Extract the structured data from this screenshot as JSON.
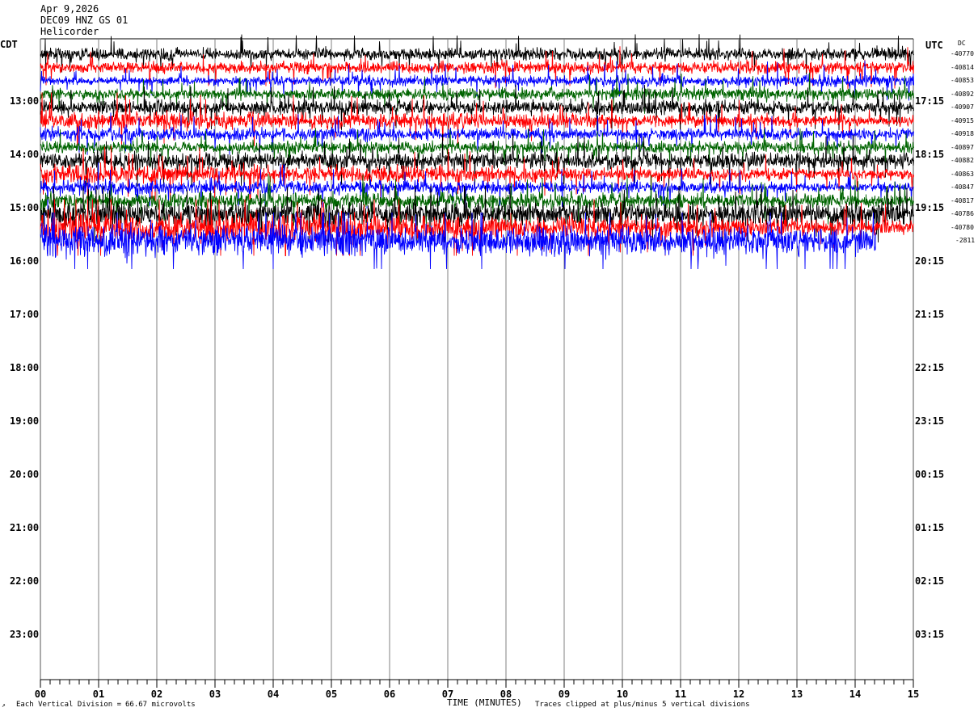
{
  "header": {
    "date": "Apr 9,2026",
    "station": "DEC09 HNZ GS 01",
    "network_label": "Helicorder"
  },
  "left_timezone": "CDT",
  "right_timezone": "UTC",
  "dc_label": "DC",
  "footer": {
    "scale_label": "Each Vertical Division =",
    "scale_value": "66.67 microvolts",
    "clip_note": "Traces clipped at plus/minus 5 vertical divisions",
    "x_axis_label": "TIME (MINUTES)"
  },
  "chart_data": {
    "type": "line",
    "title": "",
    "xlabel": "TIME (MINUTES)",
    "ylabel": "",
    "xlim": [
      0,
      15
    ],
    "x_ticks": [
      "00",
      "01",
      "02",
      "03",
      "04",
      "05",
      "06",
      "07",
      "08",
      "09",
      "10",
      "11",
      "12",
      "13",
      "14",
      "15"
    ],
    "grid": true,
    "left_hour_labels": [
      "13:00",
      "14:00",
      "15:00",
      "16:00",
      "17:00",
      "18:00",
      "19:00",
      "20:00",
      "21:00",
      "22:00",
      "23:00"
    ],
    "right_hour_labels": [
      "17:15",
      "18:15",
      "19:15",
      "20:15",
      "21:15",
      "22:15",
      "23:15",
      "00:15",
      "01:15",
      "02:15",
      "03:15"
    ],
    "trace_colors": [
      "#000000",
      "#ff0000",
      "#0000ff",
      "#006400"
    ],
    "dc_offsets": [
      "-40770",
      "-40814",
      "-40853",
      "-40892",
      "-40907",
      "-40915",
      "-40918",
      "-40897",
      "-40882",
      "-40863",
      "-40847",
      "-40817",
      "-40786",
      "-40780",
      "-2811"
    ],
    "series": [
      {
        "values": [
          0.35,
          0.38
        ]
      },
      {
        "values": [
          0.33,
          0.4
        ]
      },
      {
        "values": [
          0.25,
          0.4
        ]
      },
      {
        "values": [
          0.28,
          0.42
        ]
      },
      {
        "values": [
          0.45,
          0.4
        ]
      },
      {
        "values": [
          0.55,
          0.35
        ]
      },
      {
        "values": [
          0.42,
          0.32
        ]
      },
      {
        "values": [
          0.35,
          0.38
        ]
      },
      {
        "values": [
          0.5,
          0.48
        ]
      },
      {
        "values": [
          0.62,
          0.3
        ]
      },
      {
        "values": [
          0.5,
          0.28
        ]
      },
      {
        "values": [
          0.55,
          0.42
        ]
      },
      {
        "values": [
          0.7,
          0.68
        ]
      },
      {
        "values": [
          1.0,
          0.45
        ]
      },
      {
        "values": [
          1.0,
          0.8
        ]
      }
    ],
    "last_trace_end_minute": 14.35,
    "clip_divisions": 5
  }
}
